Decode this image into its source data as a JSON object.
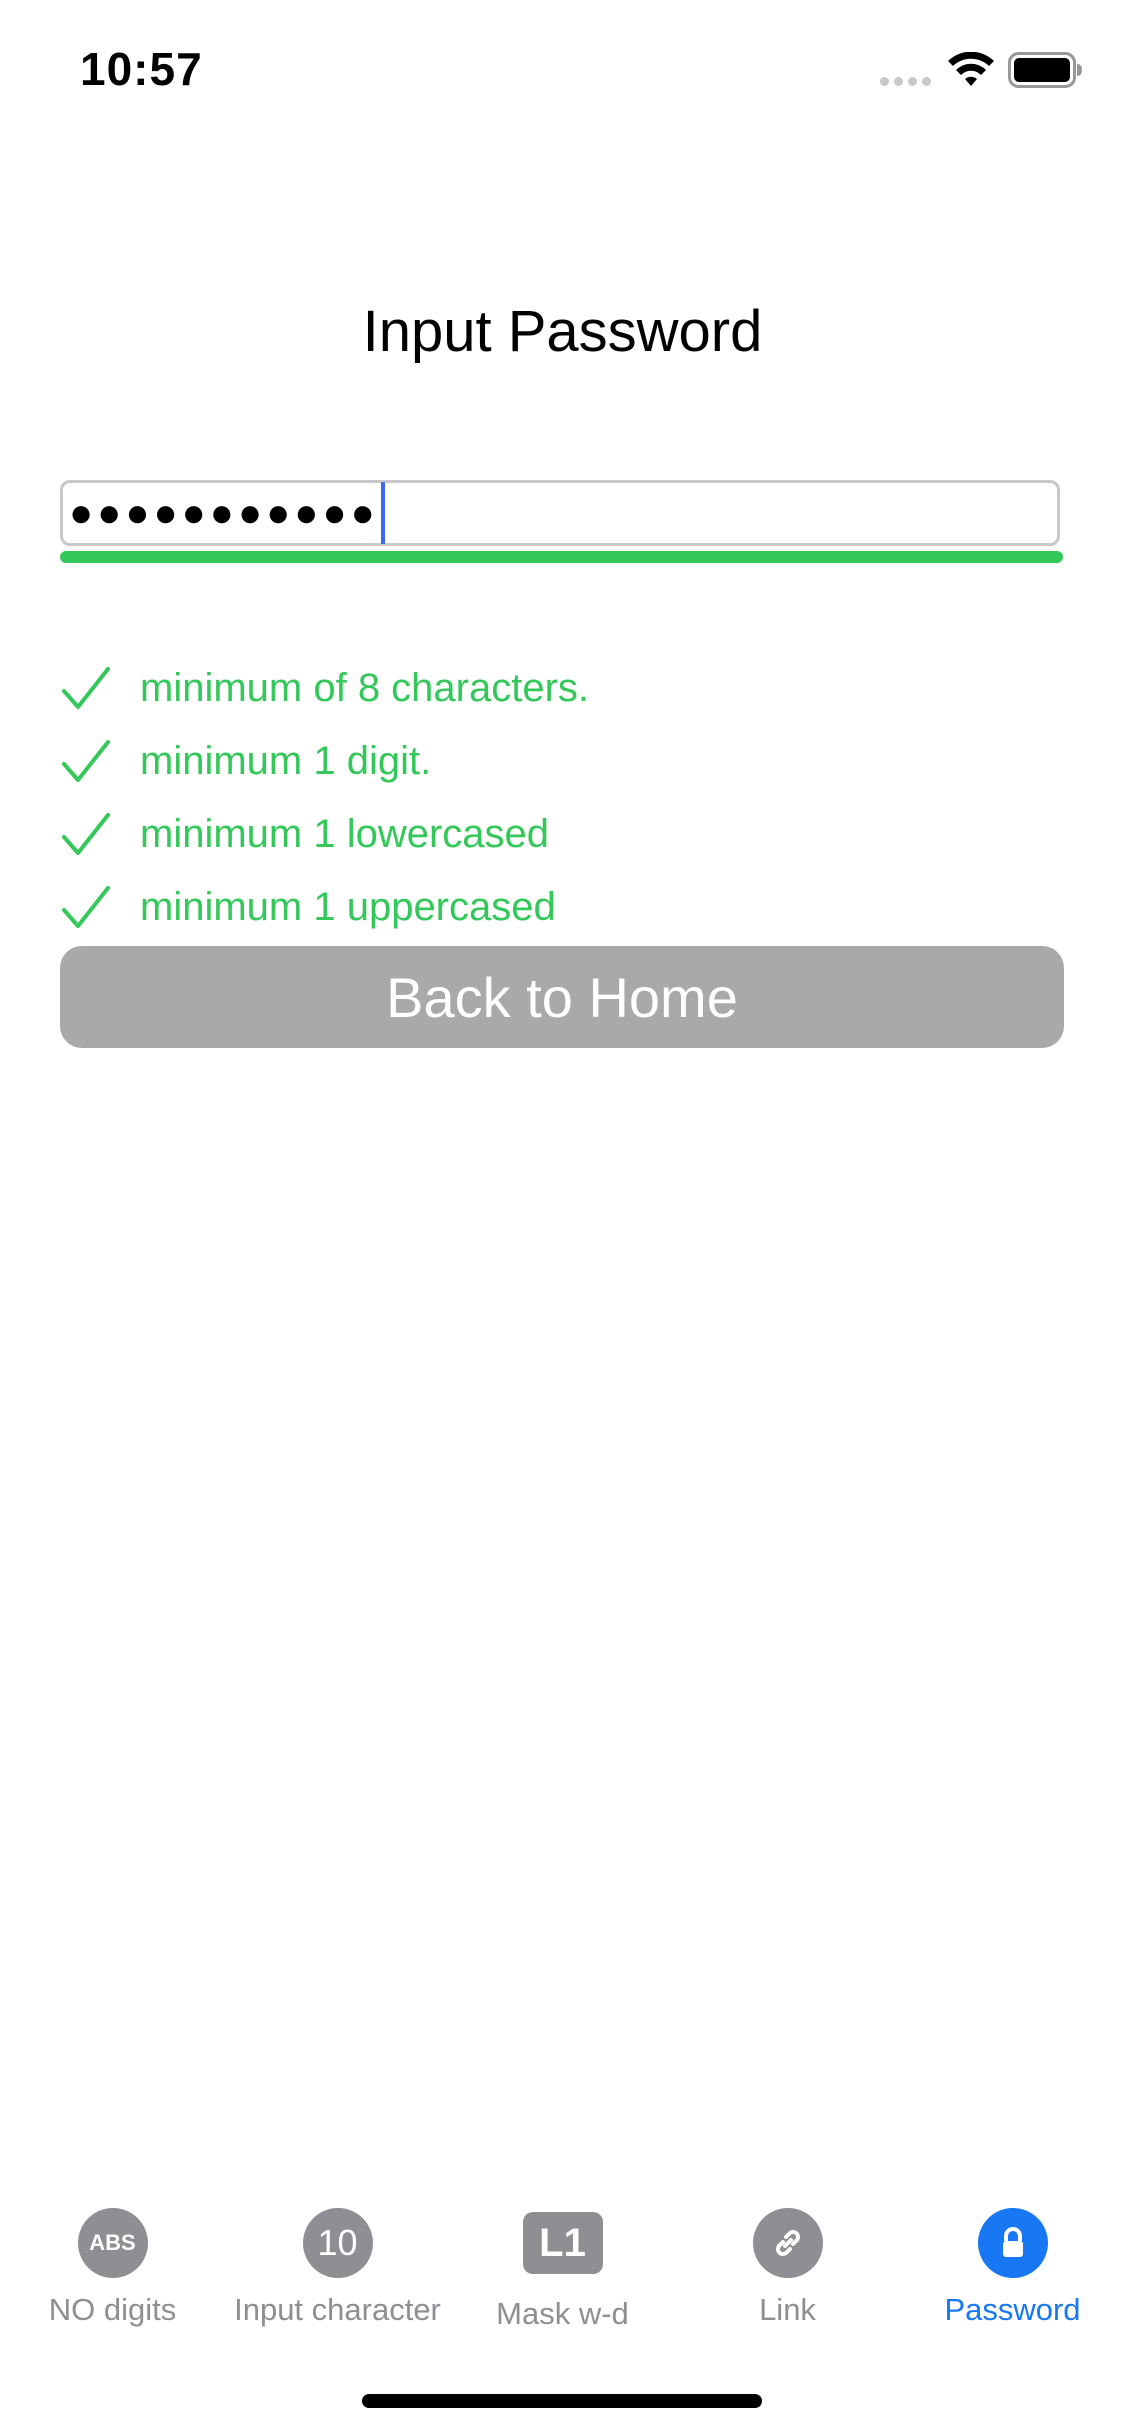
{
  "status_bar": {
    "time": "10:57"
  },
  "title": "Input Password",
  "password_field": {
    "value_masked": "●●●●●●●●●●●",
    "strength_percent": 100,
    "strength_color": "#34c759"
  },
  "requirements": [
    {
      "label": "minimum of 8 characters.",
      "met": true
    },
    {
      "label": "minimum 1 digit.",
      "met": true
    },
    {
      "label": "minimum 1 lowercased",
      "met": true
    },
    {
      "label": "minimum 1 uppercased",
      "met": true
    }
  ],
  "back_button": {
    "label": "Back to Home"
  },
  "tabs": [
    {
      "label": "NO digits",
      "icon_text": "ABS",
      "icon": "abs-icon",
      "active": false
    },
    {
      "label": "Input character",
      "icon_text": "10",
      "icon": "number-10-icon",
      "active": false
    },
    {
      "label": "Mask w-d",
      "icon_text": "L1",
      "icon": "l1-icon",
      "active": false
    },
    {
      "label": "Link",
      "icon_text": "",
      "icon": "link-icon",
      "active": false
    },
    {
      "label": "Password",
      "icon_text": "",
      "icon": "lock-icon",
      "active": true
    }
  ],
  "colors": {
    "accent": "#1877f2",
    "success": "#34c759",
    "inactive": "#8e8e93",
    "button_disabled": "#a9a9a9"
  }
}
